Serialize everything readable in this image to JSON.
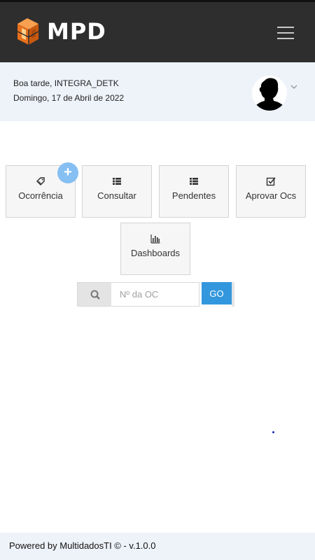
{
  "header": {
    "logo_text": "MPD",
    "menu_icon": "hamburger-icon"
  },
  "greeting": {
    "salutation": "Boa tarde, INTEGRA_DETK",
    "date": "Domingo, 17 de Abril de 2022"
  },
  "actions": [
    {
      "label": "Ocorrência",
      "icon": "tag-icon"
    },
    {
      "label": "Consultar",
      "icon": "list-icon"
    },
    {
      "label": "Pendentes",
      "icon": "list-icon"
    },
    {
      "label": "Aprovar Ocs",
      "icon": "check-square-icon"
    },
    {
      "label": "Dashboards",
      "icon": "bar-chart-icon"
    }
  ],
  "add_button_label": "+",
  "search": {
    "placeholder": "Nº da OC",
    "button_label": "GO"
  },
  "footer": {
    "text": "Powered by MultidadosTI © - v.1.0.0"
  },
  "colors": {
    "header_bg": "#2e2e2e",
    "greeting_bg": "#eef2f9",
    "accent": "#3397de",
    "plus_badge": "#86bff2",
    "logo_orange": "#f47d20"
  }
}
